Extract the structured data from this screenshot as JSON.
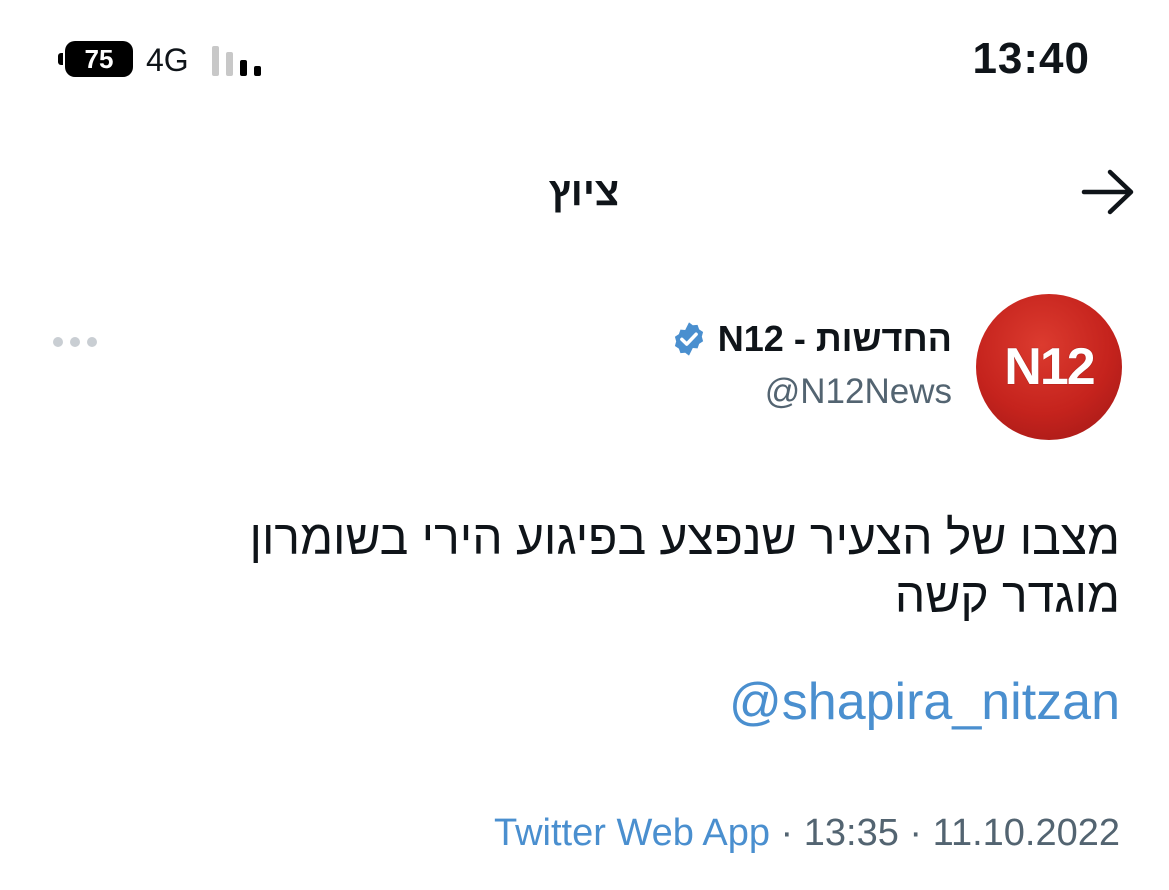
{
  "status_bar": {
    "time": "13:40",
    "battery_level": "75",
    "network": "4G",
    "signal_bars": 2
  },
  "header": {
    "title": "ציוץ",
    "back_icon": "arrow-right-icon"
  },
  "tweet": {
    "author_name": "החדשות - N12",
    "author_handle": "@N12News",
    "verified": true,
    "avatar_text": "N12",
    "body_lines": [
      "מצבו של הצעיר שנפצע בפיגוע הירי בשומרון",
      "מוגדר קשה"
    ],
    "mention": "@shapira_nitzan",
    "source": "Twitter Web App",
    "time": "13:35",
    "date": "11.10.2022",
    "separator": " · "
  },
  "colors": {
    "link": "#4a8fcf",
    "verified": "#1d9bf0",
    "avatar_red": "#c5231d",
    "secondary_text": "#536471"
  }
}
